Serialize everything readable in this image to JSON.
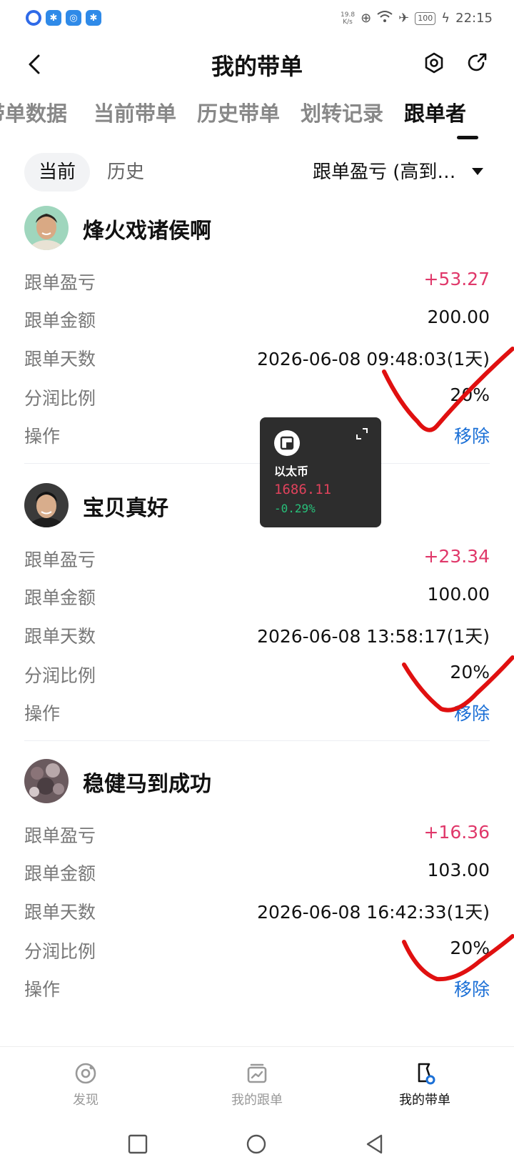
{
  "status_bar": {
    "net_speed_value": "19.8",
    "net_speed_unit": "K/s",
    "battery": "100",
    "time": "22:15"
  },
  "header": {
    "title": "我的带单"
  },
  "tabs": [
    {
      "label": "带单数据"
    },
    {
      "label": "当前带单"
    },
    {
      "label": "历史带单"
    },
    {
      "label": "划转记录"
    },
    {
      "label": "跟单者",
      "active": true
    }
  ],
  "filter": {
    "current_label": "当前",
    "history_label": "历史",
    "sort_label": "跟单盈亏 (高到…"
  },
  "followers": [
    {
      "name": "烽火戏诸侯啊",
      "rows": [
        {
          "label": "跟单盈亏",
          "value": "+53.27"
        },
        {
          "label": "跟单金额",
          "value": "200.00"
        },
        {
          "label": "跟单天数",
          "value": "2026-06-08 09:48:03(1天)"
        },
        {
          "label": "分润比例",
          "value": "20%"
        },
        {
          "label": "操作",
          "value": "移除"
        }
      ]
    },
    {
      "name": "宝贝真好",
      "rows": [
        {
          "label": "跟单盈亏",
          "value": "+23.34"
        },
        {
          "label": "跟单金额",
          "value": "100.00"
        },
        {
          "label": "跟单天数",
          "value": "2026-06-08 13:58:17(1天)"
        },
        {
          "label": "分润比例",
          "value": "20%"
        },
        {
          "label": "操作",
          "value": "移除"
        }
      ]
    },
    {
      "name": "稳健马到成功",
      "rows": [
        {
          "label": "跟单盈亏",
          "value": "+16.36"
        },
        {
          "label": "跟单金额",
          "value": "103.00"
        },
        {
          "label": "跟单天数",
          "value": "2026-06-08 16:42:33(1天)"
        },
        {
          "label": "分润比例",
          "value": "20%"
        },
        {
          "label": "操作",
          "value": "移除"
        }
      ]
    }
  ],
  "widget": {
    "name": "以太币",
    "price": "1686.11",
    "change": "-0.29%"
  },
  "bottom_nav": [
    {
      "label": "发现"
    },
    {
      "label": "我的跟单"
    },
    {
      "label": "我的带单",
      "active": true
    }
  ],
  "colors": {
    "profit": "#e0386a",
    "action": "#1a6fd6",
    "accent": "#1a6fd6",
    "widget_bg": "#2d2d2d",
    "widget_price": "#e0425c",
    "widget_change": "#27c07a",
    "annotation": "#e01010"
  }
}
